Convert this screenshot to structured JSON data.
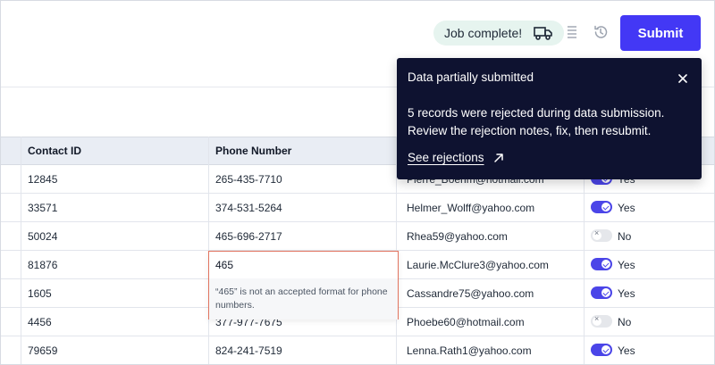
{
  "toolbar": {
    "job_status": "Job complete!",
    "submit_label": "Submit"
  },
  "table": {
    "headers": [
      "Contact ID",
      "Phone Number"
    ],
    "rows": [
      {
        "id": "12845",
        "phone": "265-435-7710",
        "email": "Pierre_Boehm@hotmail.com",
        "consent": true,
        "consent_label": "Yes"
      },
      {
        "id": "33571",
        "phone": "374-531-5264",
        "email": "Helmer_Wolff@yahoo.com",
        "consent": true,
        "consent_label": "Yes"
      },
      {
        "id": "50024",
        "phone": "465-696-2717",
        "email": "Rhea59@yahoo.com",
        "consent": false,
        "consent_label": "No"
      },
      {
        "id": "81876",
        "phone": "465",
        "email": "Laurie.McClure3@yahoo.com",
        "consent": true,
        "consent_label": "Yes"
      },
      {
        "id": "1605",
        "phone": "",
        "email": "Cassandre75@yahoo.com",
        "consent": true,
        "consent_label": "Yes"
      },
      {
        "id": "4456",
        "phone": "377-977-7675",
        "email": "Phoebe60@hotmail.com",
        "consent": false,
        "consent_label": "No"
      },
      {
        "id": "79659",
        "phone": "824-241-7519",
        "email": "Lenna.Rath1@yahoo.com",
        "consent": true,
        "consent_label": "Yes"
      }
    ]
  },
  "validation": {
    "value": "465",
    "message": "“465” is not an accepted format for phone numbers."
  },
  "toast": {
    "title": "Data partially submitted",
    "body": "5 records were rejected during data submission. Review the rejection notes, fix, then resubmit.",
    "link_label": "See rejections"
  },
  "icons": {
    "job": "truck-icon",
    "list": "list-icon",
    "history": "history-icon",
    "close": "close-icon",
    "external": "arrow-up-right-icon"
  },
  "colors": {
    "accent": "#4338f5",
    "toast_bg": "#0e1230",
    "error_border": "#e2745f",
    "job_pill_bg": "#e6f4ef"
  }
}
